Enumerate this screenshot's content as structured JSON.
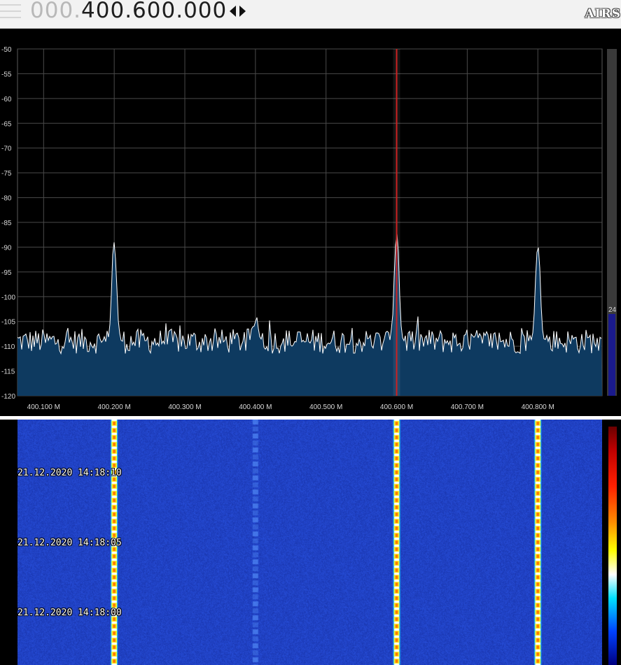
{
  "header": {
    "freq_dim": "000.",
    "freq_main": "400.600.000",
    "logo": "AIRS",
    "menu_icon": "hamburger-menu-icon",
    "tune_icon": "left-right-arrows-icon"
  },
  "spectrum": {
    "y_labels": [
      "-50",
      "-55",
      "-60",
      "-65",
      "-70",
      "-75",
      "-80",
      "-85",
      "-90",
      "-95",
      "-100",
      "-105",
      "-110",
      "-115",
      "-120"
    ],
    "x_labels": [
      "400.100 M",
      "400.200 M",
      "400.300 M",
      "400.400 M",
      "400.500 M",
      "400.600 M",
      "400.700 M",
      "400.800 M"
    ],
    "x_values_mhz": [
      400.1,
      400.2,
      400.3,
      400.4,
      400.5,
      400.6,
      400.7,
      400.8
    ],
    "db_range": [
      -120,
      -50
    ],
    "freq_range_mhz": [
      400.063,
      400.891
    ],
    "center_mhz": 400.6,
    "noise_floor_db": -109,
    "peaks": [
      {
        "freq_mhz": 400.2,
        "level_db": -87
      },
      {
        "freq_mhz": 400.4,
        "level_db": -103
      },
      {
        "freq_mhz": 400.6,
        "level_db": -85
      },
      {
        "freq_mhz": 400.8,
        "level_db": -87.5
      }
    ],
    "squelch_value": "24",
    "squelch_fraction": 0.8,
    "colors": {
      "fill": "#0e3a60",
      "line": "#ffffff",
      "grid": "#4a4a4a",
      "marker": "#cc2222",
      "level_bar": "#1a1a8c"
    }
  },
  "waterfall": {
    "timestamps": [
      "21.12.2020 14:18:10",
      "21.12.2020 14:18:05",
      "21.12.2020 14:18:00"
    ],
    "signals_mhz": [
      400.2,
      400.4,
      400.6,
      400.8
    ],
    "colors": {
      "background": "#1a35b5",
      "carrier_core": "#ff7a00",
      "carrier_edge": "#ffff20"
    }
  }
}
